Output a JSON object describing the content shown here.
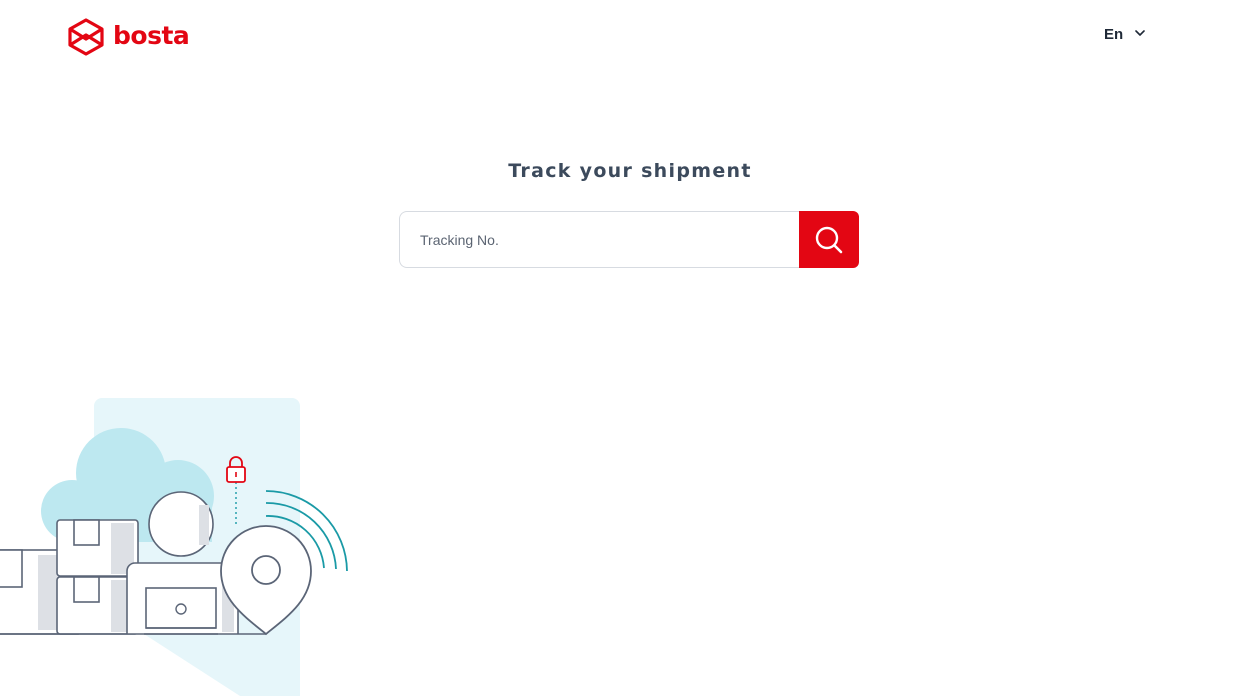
{
  "brand": {
    "name": "bosta",
    "color": "#e30613"
  },
  "language": {
    "selected": "En"
  },
  "main": {
    "title": "Track your shipment",
    "search": {
      "placeholder": "Tracking No.",
      "value": "",
      "button_icon": "search-icon"
    }
  },
  "icons": {
    "logo": "bosta-box-logo-icon",
    "language_toggle": "chevron-down-icon",
    "search": "search-icon",
    "illustration": "tracking-illustration"
  },
  "colors": {
    "accent": "#e30613",
    "title": "#3c4a5c",
    "illustration_light_blue": "#e6f6fa",
    "illustration_cloud": "#bde8f0",
    "illustration_line": "#5b6577",
    "illustration_signal": "#1a9aa6"
  }
}
